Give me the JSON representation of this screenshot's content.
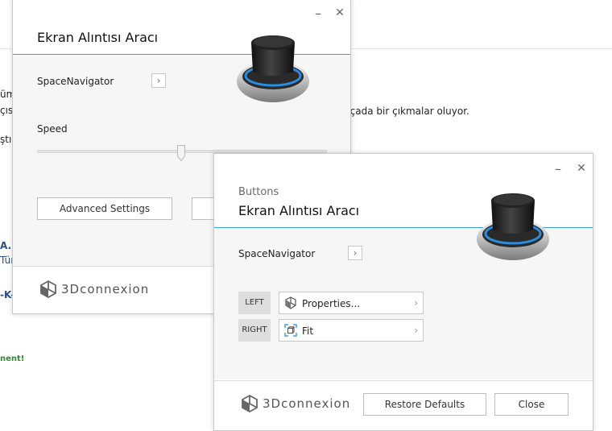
{
  "background": {
    "fragments": [
      "üm",
      "çısı",
      "rçada bir çıkmalar oluyor.",
      "ştır",
      "A.",
      "Tür",
      "-K-",
      "nent!"
    ]
  },
  "window_a": {
    "title": "Ekran Alıntısı Aracı",
    "minimize": "–",
    "close": "✕",
    "device_label": "SpaceNavigator",
    "speed_label": "Speed",
    "speed_value": 0.5,
    "advanced_button": "Advanced Settings",
    "brand": "3Dconnexion"
  },
  "window_b": {
    "subtitle": "Buttons",
    "title": "Ekran Alıntısı Aracı",
    "minimize": "–",
    "close": "✕",
    "device_label": "SpaceNavigator",
    "mappings": [
      {
        "button": "LEFT",
        "action": "Properties...",
        "icon": "cube-properties-icon"
      },
      {
        "button": "RIGHT",
        "action": "Fit",
        "icon": "fit-view-icon"
      }
    ],
    "restore_button": "Restore Defaults",
    "close_button": "Close",
    "brand": "3Dconnexion"
  },
  "colors": {
    "accent": "#3aa0d8",
    "device_ring": "#2a8de0"
  }
}
